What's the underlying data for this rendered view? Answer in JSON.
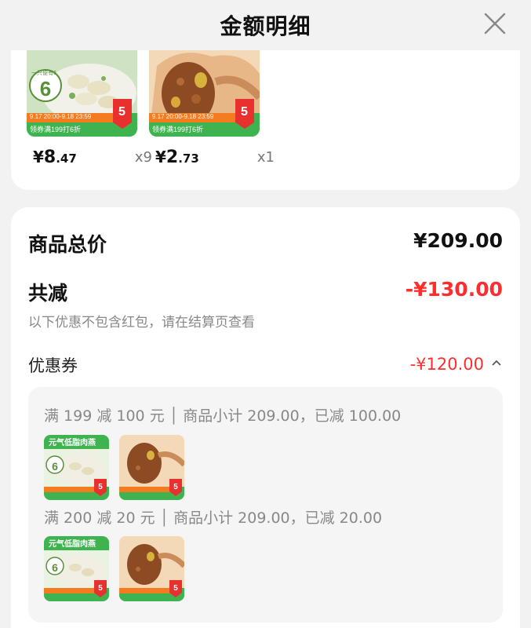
{
  "header": {
    "title": "金额明细",
    "close_icon": "close-icon"
  },
  "products": [
    {
      "price_yen": "¥",
      "price_int": "8",
      "price_dec": ".47",
      "qty": "x9",
      "image": "dumpling-product-image",
      "promo_text": "领券满199打6折",
      "promo_date": "9.17 20:00-9.18 23:59",
      "badge_num": "5",
      "tag_text": "一只便有6"
    },
    {
      "price_yen": "¥",
      "price_int": "2",
      "price_dec": ".73",
      "qty": "x1",
      "image": "zongzi-product-image",
      "promo_text": "领券满199打6折",
      "promo_date": "9.17 20:00-9.18 23:59",
      "badge_num": "5"
    }
  ],
  "summary": {
    "total_label": "商品总价",
    "total_value": "¥209.00",
    "discount_label": "共减",
    "discount_value": "-¥130.00",
    "note": "以下优惠不包含红包，请在结算页查看",
    "coupon_label": "优惠券",
    "coupon_value": "-¥120.00"
  },
  "coupon_rules": [
    {
      "text": "满 199 减 100 元 │ 商品小计 209.00，已减 100.00"
    },
    {
      "text": "满 200 减 20 元 │ 商品小计 209.00，已减 20.00"
    }
  ],
  "thumb_text": {
    "green_banner": "元气低脂肉燕"
  },
  "colors": {
    "accent_red": "#ff2d2d",
    "promo_green": "#3fb34f",
    "badge_red": "#e8312f"
  }
}
